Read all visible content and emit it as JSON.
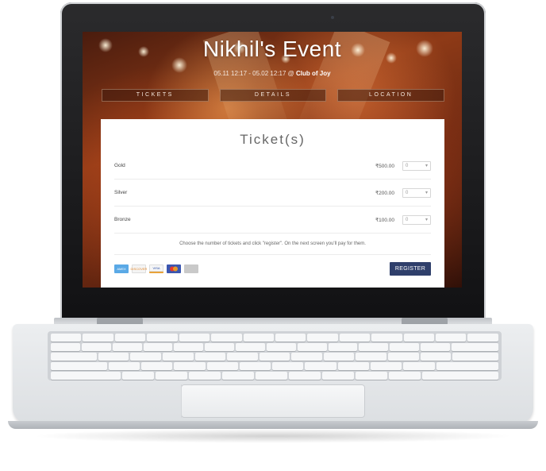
{
  "event": {
    "title": "Nikhil's Event",
    "dates": "05.11 12:17 - 05.02 12:17 @ ",
    "venue": "Club of Joy"
  },
  "tabs": [
    {
      "label": "TICKETS"
    },
    {
      "label": "DETAILS"
    },
    {
      "label": "LOCATION"
    }
  ],
  "tickets": {
    "heading": "Ticket(s)",
    "rows": [
      {
        "name": "Gold",
        "price": "₹500.00",
        "qty": "0"
      },
      {
        "name": "Silver",
        "price": "₹200.00",
        "qty": "0"
      },
      {
        "name": "Bronze",
        "price": "₹100.00",
        "qty": "0"
      }
    ],
    "hint": "Choose the number of tickets and click \"register\". On the next screen you'll pay for them.",
    "register_label": "REGISTER"
  },
  "payment_icons": [
    {
      "icon": "amex-card-icon",
      "label": "AMEX",
      "color": "#5aa9e6"
    },
    {
      "icon": "discover-card-icon",
      "label": "DISCOVER",
      "color": "#f0a35a"
    },
    {
      "icon": "visa-card-icon",
      "label": "VISA",
      "color": "#2a4fa8"
    },
    {
      "icon": "mastercard-card-icon",
      "label": "",
      "color": "#3b56b0"
    },
    {
      "icon": "generic-card-icon",
      "label": "",
      "color": "#c9c9c9"
    }
  ],
  "colors": {
    "register_button": "#2f3f6b",
    "screen_background": "#8e3a17"
  }
}
